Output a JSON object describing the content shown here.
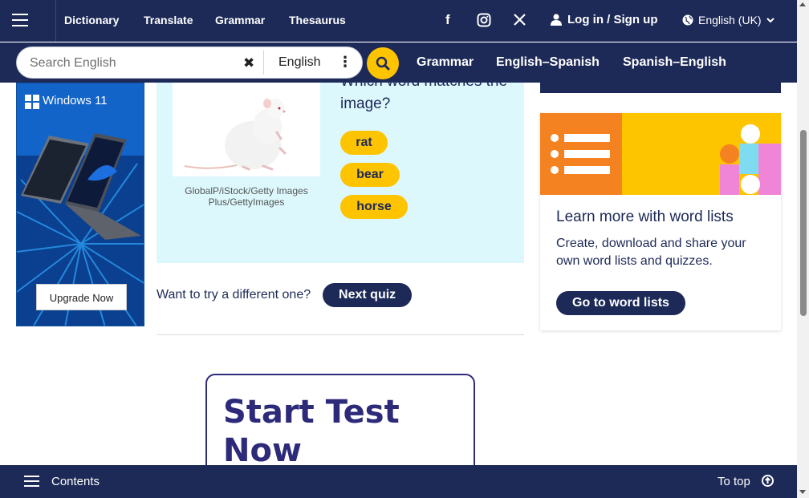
{
  "topnav": {
    "links": [
      "Dictionary",
      "Translate",
      "Grammar",
      "Thesaurus"
    ],
    "login_label": "Log in / Sign up",
    "language": "English (UK)",
    "social_icons": [
      "facebook-icon",
      "instagram-icon",
      "x-icon"
    ]
  },
  "search": {
    "placeholder": "Search English",
    "dictionary": "English",
    "links": [
      "Grammar",
      "English–Spanish",
      "Spanish–English"
    ]
  },
  "ad": {
    "brand": "Windows 11",
    "button": "Upgrade Now"
  },
  "quiz": {
    "question": "Which word matches the image?",
    "image_credit": "GlobalP/iStock/Getty Images Plus/GettyImages",
    "answers": [
      "rat",
      "bear",
      "horse"
    ],
    "try_text": "Want to try a different one?",
    "next_button": "Next quiz"
  },
  "start_test": {
    "title": "Start Test Now"
  },
  "word_lists_card": {
    "title": "Learn more with word lists",
    "text": "Create, download and share your own word lists and quizzes.",
    "button": "Go to word lists"
  },
  "bottombar": {
    "contents": "Contents",
    "to_top": "To top"
  },
  "colors": {
    "navy": "#1d2a57",
    "yellow": "#fec400",
    "quiz_bg": "#dcf8fd",
    "orange": "#f58220"
  }
}
